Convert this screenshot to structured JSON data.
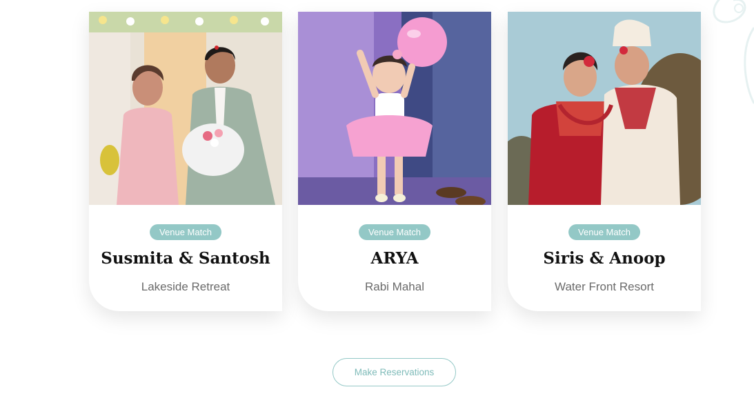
{
  "cards": [
    {
      "badge": "Venue Match",
      "name": "Susmita & Santosh",
      "venue": "Lakeside Retreat"
    },
    {
      "badge": "Venue Match",
      "name": "ARYA",
      "venue": "Rabi Mahal"
    },
    {
      "badge": "Venue Match",
      "name": "Siris & Anoop",
      "venue": "Water Front Resort"
    }
  ],
  "cta": {
    "label": "Make Reservations"
  },
  "colors": {
    "accent": "#93c8c6",
    "cta_text": "#7fbbb9",
    "title": "#111111",
    "subtitle": "#6a6a6a"
  }
}
